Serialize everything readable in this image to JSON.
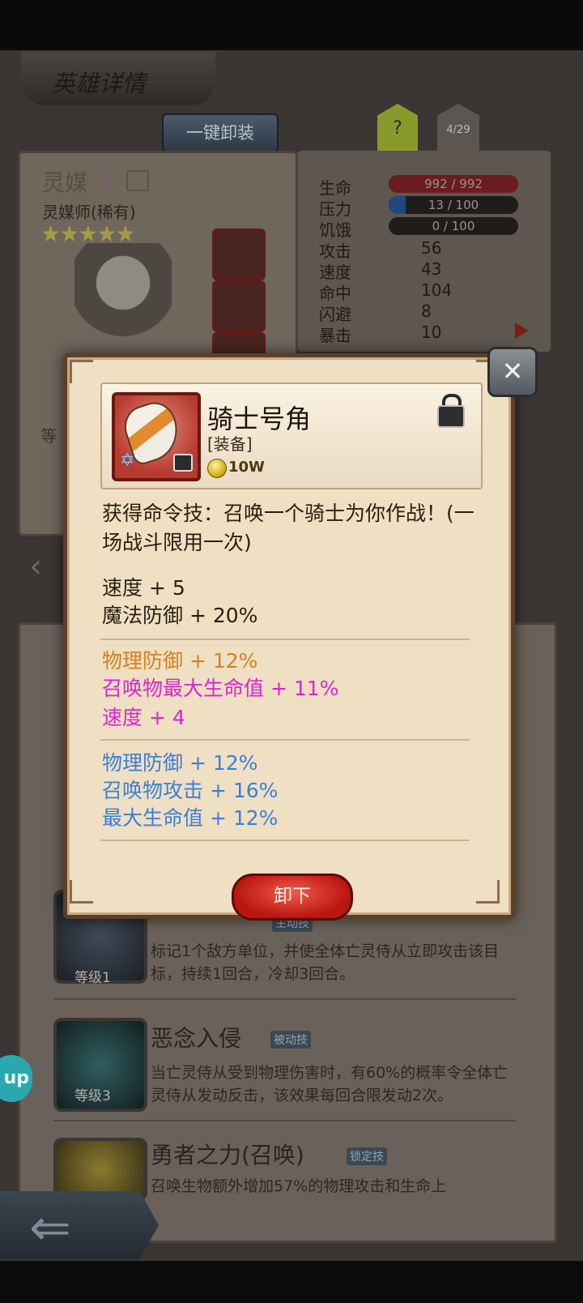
{
  "screen": {
    "title": "英雄详情",
    "one_click_unequip": "一键卸装",
    "help": "?",
    "hero_count": "4/29"
  },
  "hero": {
    "name": "灵媒",
    "gender_symbol": "♀",
    "class_rarity": "灵媒师(稀有)",
    "stars": "★★★★★",
    "level_fragment": "等"
  },
  "stats": {
    "hp_label": "生命",
    "hp_value": "992 / 992",
    "stress_label": "压力",
    "stress_value": "13 / 100",
    "hunger_label": "饥饿",
    "hunger_value": "0 / 100",
    "attack_label": "攻击",
    "attack_value": "56",
    "speed_label": "速度",
    "speed_value": "43",
    "hit_label": "命中",
    "hit_value": "104",
    "dodge_label": "闪避",
    "dodge_value": "8",
    "crit_label": "暴击",
    "crit_value": "10"
  },
  "skills": [
    {
      "name_fragment": "",
      "tag": "主动技",
      "desc": "标记1个敌方单位，并使全体亡灵侍从立即攻击该目标，持续1回合，冷却3回合。",
      "level": "等级1"
    },
    {
      "name": "恶念入侵",
      "tag": "被动技",
      "desc": "当亡灵侍从受到物理伤害时，有60%的概率令全体亡灵侍从发动反击，该效果每回合限发动2次。",
      "level": "等级3"
    },
    {
      "name": "勇者之力(召唤)",
      "tag": "锁定技",
      "desc": "召唤生物额外增加57%的物理攻击和生命上"
    }
  ],
  "side_badge": "up",
  "popup": {
    "item_name": "骑士号角",
    "item_type": "[装备]",
    "price": "10W",
    "description": "获得命令技：召唤一个骑士为你作战！(一场战斗限用一次)",
    "base_stats": [
      "速度 + 5",
      "魔法防御 + 20%"
    ],
    "bonus_group_1": [
      {
        "text": "物理防御 + 12%",
        "color": "#d8811c"
      },
      {
        "text": "召唤物最大生命值 + 11%",
        "color": "#e023cf"
      },
      {
        "text": "速度 + 4",
        "color": "#e023cf"
      }
    ],
    "bonus_group_2": [
      {
        "text": "物理防御 + 12%",
        "color": "#3c7fd8"
      },
      {
        "text": "召唤物攻击 + 16%",
        "color": "#3c7fd8"
      },
      {
        "text": "最大生命值 + 12%",
        "color": "#3c7fd8"
      }
    ],
    "unequip_label": "卸下",
    "close_icon": "crossed-swords-close-icon",
    "lock_icon": "padlock-icon"
  },
  "progress": {
    "hp_fraction": 1.0,
    "stress_fraction": 0.13,
    "hunger_fraction": 0.0
  }
}
